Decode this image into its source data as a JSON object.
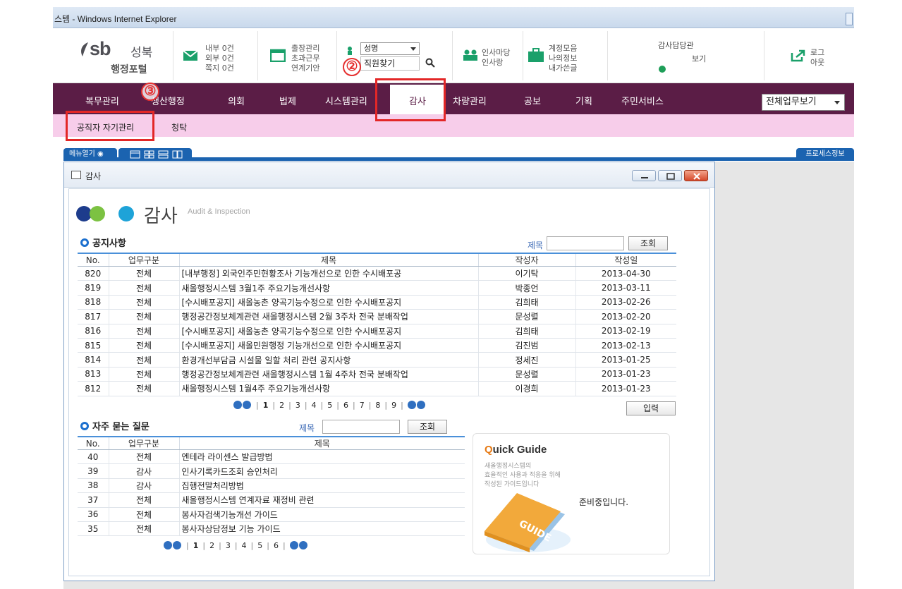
{
  "browser": {
    "title": "스템 - Windows Internet Explorer"
  },
  "logo": {
    "sb": "sb",
    "city": "성북",
    "sub": "행정포털"
  },
  "header": {
    "mail": [
      "내부 0건",
      "외부 0건",
      "쪽지 0건"
    ],
    "trip": [
      "출장관리",
      "초과근무",
      "연계기안"
    ],
    "search": {
      "select": "성명",
      "placeholder": "직원찾기"
    },
    "hr": [
      "인사마당",
      "인사랑"
    ],
    "account": [
      "계정모음",
      "나의정보",
      "내가쓴글"
    ],
    "auditor": {
      "title": "감사담당관",
      "view": "보기"
    },
    "logout": [
      "로그",
      "아웃"
    ]
  },
  "annotations": [
    "②",
    "③"
  ],
  "nav": {
    "items": [
      "복무관리",
      "생산행정",
      "의회",
      "법제",
      "시스템관리",
      "감사",
      "차량관리",
      "공보",
      "기획",
      "주민서비스"
    ],
    "active": "감사",
    "all_view": "전체업무보기"
  },
  "subnav": {
    "items": [
      "공직자 자기관리",
      "청탁"
    ]
  },
  "tabs": {
    "menu_open": "메뉴열기",
    "process_info": "프로세스정보"
  },
  "window": {
    "title": "감사"
  },
  "page": {
    "title": "감사",
    "subtitle": "Audit & Inspection"
  },
  "notice": {
    "title": "공지사항",
    "search_label": "제목",
    "search_button": "조회",
    "columns": [
      "No.",
      "업무구분",
      "제목",
      "작성자",
      "작성일"
    ],
    "rows": [
      {
        "no": "820",
        "cat": "전체",
        "title": "[내부행정] 외국인주민현황조사 기능개선으로 인한 수시배포공",
        "author": "이기탁",
        "date": "2013-04-30"
      },
      {
        "no": "819",
        "cat": "전체",
        "title": "새올행정시스템 3월1주 주요기능개선사항",
        "author": "박종언",
        "date": "2013-03-11"
      },
      {
        "no": "818",
        "cat": "전체",
        "title": "[수시배포공지] 새올농촌 양곡기능수정으로 인한 수시배포공지",
        "author": "김희태",
        "date": "2013-02-26"
      },
      {
        "no": "817",
        "cat": "전체",
        "title": "행정공간정보체계관련 새올행정시스템 2월 3주차 전국 분배작업",
        "author": "문성렬",
        "date": "2013-02-20"
      },
      {
        "no": "816",
        "cat": "전체",
        "title": "[수시배포공지] 새올농촌 양곡기능수정으로 인한 수시배포공지",
        "author": "김희태",
        "date": "2013-02-19"
      },
      {
        "no": "815",
        "cat": "전체",
        "title": "[수시배포공지] 새올민원행정 기능개선으로 인한 수시배포공지",
        "author": "김진범",
        "date": "2013-02-13"
      },
      {
        "no": "814",
        "cat": "전체",
        "title": "환경개선부담금 시설물 일할 처리 관련 공지사항",
        "author": "정세진",
        "date": "2013-01-25"
      },
      {
        "no": "813",
        "cat": "전체",
        "title": "행정공간정보체계관련 새올행정시스템 1월 4주차 전국 분배작업",
        "author": "문성렬",
        "date": "2013-01-23"
      },
      {
        "no": "812",
        "cat": "전체",
        "title": "새올행정시스템 1월4주 주요기능개선사항",
        "author": "이경희",
        "date": "2013-01-23"
      }
    ],
    "pages": [
      "1",
      "2",
      "3",
      "4",
      "5",
      "6",
      "7",
      "8",
      "9"
    ],
    "input_button": "입력"
  },
  "faq": {
    "title": "자주 묻는 질문",
    "search_label": "제목",
    "search_button": "조회",
    "columns": [
      "No.",
      "업무구분",
      "제목"
    ],
    "rows": [
      {
        "no": "40",
        "cat": "전체",
        "title": "엔테라 라이센스 발급방법"
      },
      {
        "no": "39",
        "cat": "감사",
        "title": "인사기록카드조회 승인처리"
      },
      {
        "no": "38",
        "cat": "감사",
        "title": "집행전말처리방법"
      },
      {
        "no": "37",
        "cat": "전체",
        "title": "새올행정시스템 연계자료 재정비 관련"
      },
      {
        "no": "36",
        "cat": "전체",
        "title": "봉사자검색기능개선 가이드"
      },
      {
        "no": "35",
        "cat": "전체",
        "title": "봉사자상담정보 기능 가이드"
      }
    ],
    "pages": [
      "1",
      "2",
      "3",
      "4",
      "5",
      "6"
    ]
  },
  "guide": {
    "title_first": "Q",
    "title_rest": "uick Guide",
    "desc": [
      "새올행정시스템의",
      "효율적인 사용과 적응을 위해",
      "작성된 가이드입니다"
    ],
    "book": "GUIDE",
    "status": "준비중입니다."
  },
  "colors": {
    "nav_bg": "#5b1d46",
    "subnav_bg": "#f7cdea",
    "accent_blue": "#1b63b0",
    "annotation_red": "#e32727"
  }
}
